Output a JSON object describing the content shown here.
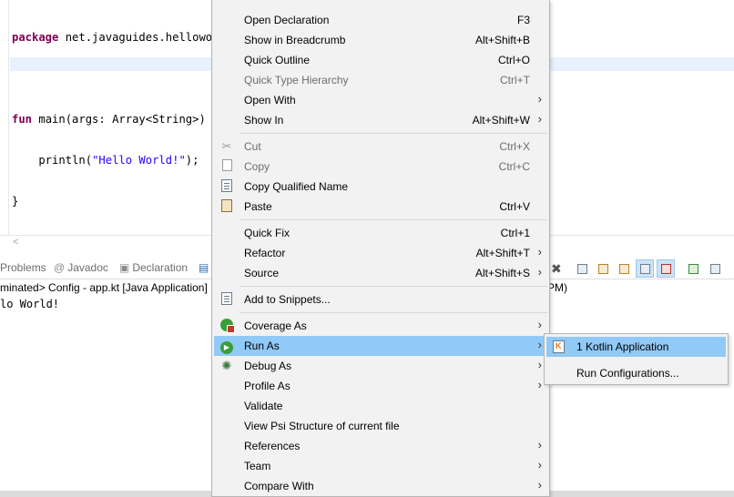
{
  "editor": {
    "lines": {
      "l1_kw": "package",
      "l1_rest": " net.javaguides.helloworl",
      "l3_kw": "fun",
      "l3_rest": " main(args: Array<String>) ",
      "l4_pre": "    println(",
      "l4_str": "\"Hello World!\"",
      "l4_post": ");",
      "l5": "}"
    },
    "scroll_left_glyph": "<"
  },
  "views": {
    "tabs": [
      {
        "label": "Problems",
        "icon": "problems-icon"
      },
      {
        "label": "Javadoc",
        "icon": "at-icon"
      },
      {
        "label": "Declaration",
        "icon": "declaration-icon"
      }
    ],
    "console_header": "minated> Config - app.kt [Java Application]",
    "console_header_right": "PM)",
    "console_output": "lo World!"
  },
  "context_menu": {
    "items": [
      {
        "label": "Open Declaration",
        "accel": "F3"
      },
      {
        "label": "Show in Breadcrumb",
        "accel": "Alt+Shift+B"
      },
      {
        "label": "Quick Outline",
        "accel": "Ctrl+O"
      },
      {
        "label": "Quick Type Hierarchy",
        "accel": "Ctrl+T",
        "disabled": true
      },
      {
        "label": "Open With",
        "accel": "",
        "submenu": true
      },
      {
        "label": "Show In",
        "accel": "Alt+Shift+W",
        "submenu": true
      },
      {
        "label": "Cut",
        "accel": "Ctrl+X",
        "disabled": true,
        "icon": "cut-icon"
      },
      {
        "label": "Copy",
        "accel": "Ctrl+C",
        "disabled": true,
        "icon": "copy-icon"
      },
      {
        "label": "Copy Qualified Name",
        "accel": "",
        "icon": "copy-qualified-name-icon"
      },
      {
        "label": "Paste",
        "accel": "Ctrl+V",
        "icon": "paste-icon"
      },
      {
        "label": "Quick Fix",
        "accel": "Ctrl+1"
      },
      {
        "label": "Refactor",
        "accel": "Alt+Shift+T",
        "submenu": true
      },
      {
        "label": "Source",
        "accel": "Alt+Shift+S",
        "submenu": true
      },
      {
        "label": "Add to Snippets...",
        "accel": "",
        "icon": "snippets-icon"
      },
      {
        "label": "Coverage As",
        "accel": "",
        "submenu": true,
        "icon": "coverage-icon"
      },
      {
        "label": "Run As",
        "accel": "",
        "submenu": true,
        "icon": "run-icon",
        "highlighted": true
      },
      {
        "label": "Debug As",
        "accel": "",
        "submenu": true,
        "icon": "debug-icon"
      },
      {
        "label": "Profile As",
        "accel": "",
        "submenu": true
      },
      {
        "label": "Validate",
        "accel": ""
      },
      {
        "label": "View Psi Structure of current file",
        "accel": ""
      },
      {
        "label": "References",
        "accel": "",
        "submenu": true
      },
      {
        "label": "Team",
        "accel": "",
        "submenu": true
      },
      {
        "label": "Compare With",
        "accel": "",
        "submenu": true
      }
    ],
    "submenu_arrow": "›"
  },
  "run_as_submenu": {
    "items": [
      {
        "label": "1 Kotlin Application",
        "icon": "kotlin-file-icon",
        "highlighted": true
      },
      {
        "label": "Run Configurations..."
      }
    ]
  },
  "colors": {
    "highlight": "#91c9f7",
    "menu_bg": "#f2f2f2",
    "keyword": "#7f0055",
    "string": "#2a00ff"
  }
}
